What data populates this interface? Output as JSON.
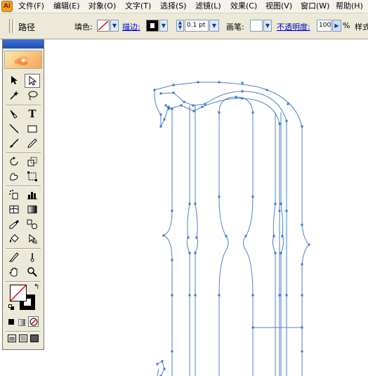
{
  "menubar": {
    "app_icon_glyph": "Ai",
    "items": [
      "文件(F)",
      "编辑(E)",
      "对象(O)",
      "文字(T)",
      "选择(S)",
      "滤镜(L)",
      "效果(C)",
      "视图(V)",
      "窗口(W)",
      "帮助(H)"
    ]
  },
  "optionsbar": {
    "context_label": "路径",
    "fill_label": "填色:",
    "stroke_label": "描边:",
    "stroke_weight": "0.1 pt",
    "brush_label": "画笔:",
    "opacity_label": "不透明度:",
    "opacity_value": "100",
    "percent": "%",
    "style_label": "样式"
  },
  "colors": {
    "path_stroke": "#4a7fcf",
    "anchor": "#3e74c9",
    "fill_none_slash": "#e0001a"
  },
  "toolbox": {
    "tools": [
      "selection-tool",
      "direct-selection-tool",
      "magic-wand-tool",
      "lasso-tool",
      "pen-tool",
      "type-tool",
      "line-segment-tool",
      "rectangle-tool",
      "paintbrush-tool",
      "pencil-tool",
      "rotate-tool",
      "scale-tool",
      "warp-tool",
      "free-transform-tool",
      "symbol-sprayer-tool",
      "column-graph-tool",
      "mesh-tool",
      "gradient-tool",
      "eyedropper-tool",
      "blend-tool",
      "live-paint-bucket-tool",
      "live-paint-selection-tool",
      "slice-tool",
      "eraser-tool",
      "hand-tool",
      "zoom-tool"
    ]
  }
}
